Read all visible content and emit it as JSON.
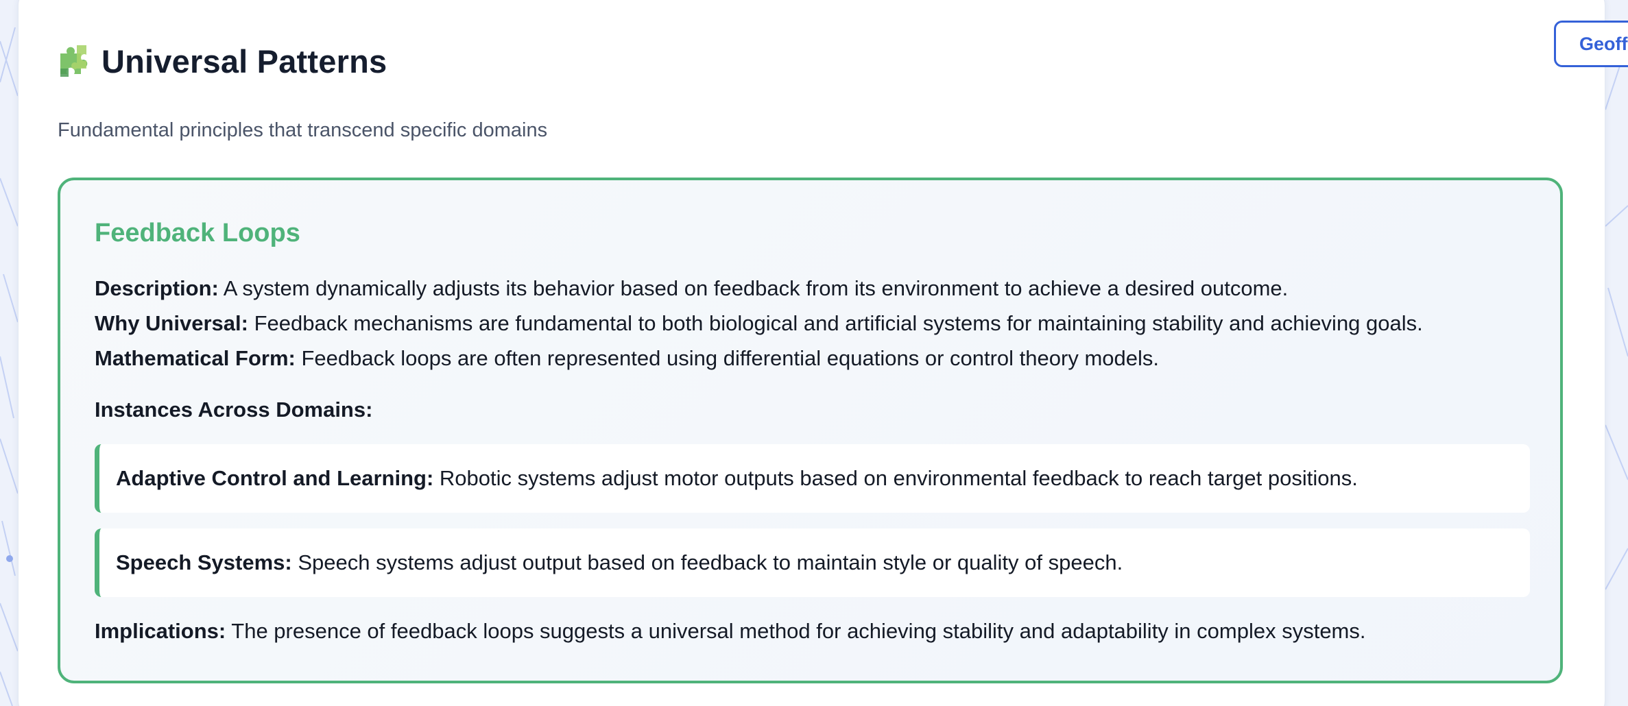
{
  "header": {
    "title": "Universal Patterns",
    "icon": "puzzle-piece-icon",
    "user_button_label": "Geoff"
  },
  "subtitle": "Fundamental principles that transcend specific domains",
  "colors": {
    "accent_green": "#4fb37a",
    "accent_blue": "#3461d8",
    "text_dark": "#141a26"
  },
  "pattern": {
    "title": "Feedback Loops",
    "description_label": "Description:",
    "description": "A system dynamically adjusts its behavior based on feedback from its environment to achieve a desired outcome.",
    "why_label": "Why Universal:",
    "why": "Feedback mechanisms are fundamental to both biological and artificial systems for maintaining stability and achieving goals.",
    "math_label": "Mathematical Form:",
    "math": "Feedback loops are often represented using differential equations or control theory models.",
    "instances_label": "Instances Across Domains:",
    "instances": [
      {
        "label": "Adaptive Control and Learning:",
        "text": "Robotic systems adjust motor outputs based on environmental feedback to reach target positions."
      },
      {
        "label": "Speech Systems:",
        "text": "Speech systems adjust output based on feedback to maintain style or quality of speech."
      }
    ],
    "implications_label": "Implications:",
    "implications": "The presence of feedback loops suggests a universal method for achieving stability and adaptability in complex systems."
  }
}
